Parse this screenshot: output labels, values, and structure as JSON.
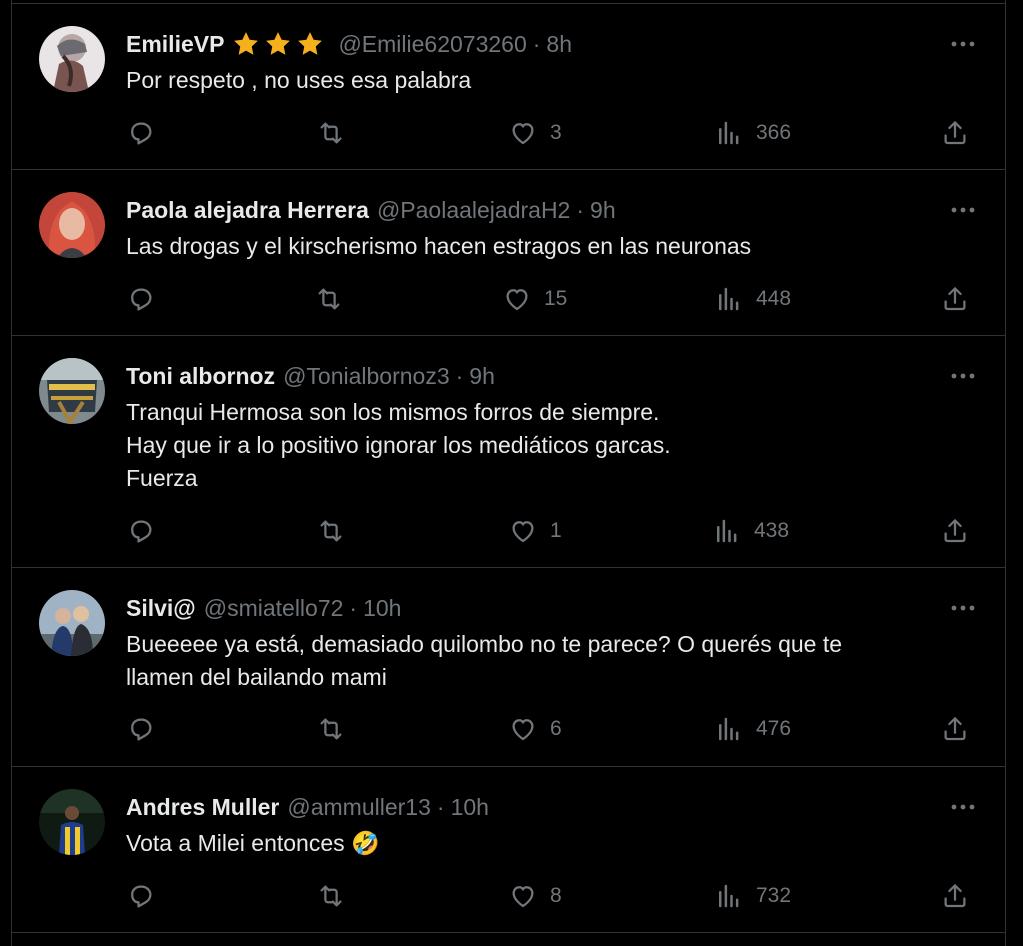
{
  "colors": {
    "background": "#000000",
    "text": "#e7e9ea",
    "secondary": "#71767b",
    "border": "#2f3336",
    "star": "#f5b01d"
  },
  "icons": {
    "reply": "reply-icon",
    "retweet": "retweet-icon",
    "like": "heart-icon",
    "views": "views-icon",
    "share": "share-icon",
    "more": "more-icon",
    "star": "star-icon"
  },
  "tweets": [
    {
      "name": "EmilieVP",
      "stars": 3,
      "handle": "@Emilie62073260",
      "separator": "·",
      "time": "8h",
      "lines": [
        "Por respeto  , no uses esa palabra"
      ],
      "likes": "3",
      "views": "366"
    },
    {
      "name": "Paola alejadra Herrera",
      "handle": "@PaolaalejadraH2",
      "separator": "·",
      "time": "9h",
      "lines": [
        "Las drogas y el kirscherismo hacen estragos en las neuronas"
      ],
      "likes": "15",
      "views": "448"
    },
    {
      "name": "Toni albornoz",
      "handle": "@Tonialbornoz3",
      "separator": "·",
      "time": "9h",
      "lines": [
        "Tranqui Hermosa son los mismos forros de siempre.",
        "Hay que ir a lo positivo ignorar los mediáticos garcas.",
        "Fuerza"
      ],
      "likes": "1",
      "views": "438"
    },
    {
      "name": "Silvi@",
      "handle": "@smiatello72",
      "separator": "·",
      "time": "10h",
      "lines": [
        "Bueeeee ya está, demasiado quilombo no te parece? O querés que te",
        "llamen del bailando mami"
      ],
      "likes": "6",
      "views": "476"
    },
    {
      "name": "Andres Muller",
      "handle": "@ammuller13",
      "separator": "·",
      "time": "10h",
      "lines": [
        "Vota a Milei entonces 🤣"
      ],
      "likes": "8",
      "views": "732"
    }
  ]
}
